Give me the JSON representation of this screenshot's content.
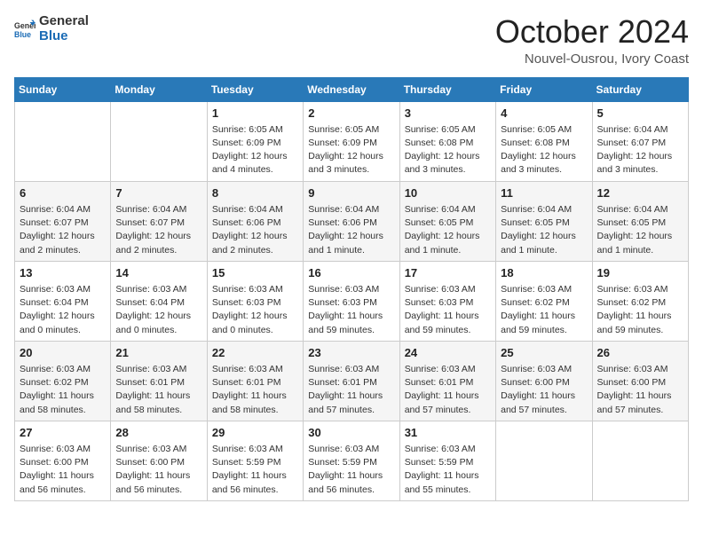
{
  "logo": {
    "text_general": "General",
    "text_blue": "Blue",
    "tagline": "GeneralBlue"
  },
  "header": {
    "month": "October 2024",
    "location": "Nouvel-Ousrou, Ivory Coast"
  },
  "days_of_week": [
    "Sunday",
    "Monday",
    "Tuesday",
    "Wednesday",
    "Thursday",
    "Friday",
    "Saturday"
  ],
  "weeks": [
    [
      {
        "day": "",
        "info": ""
      },
      {
        "day": "",
        "info": ""
      },
      {
        "day": "1",
        "info": "Sunrise: 6:05 AM\nSunset: 6:09 PM\nDaylight: 12 hours and 4 minutes."
      },
      {
        "day": "2",
        "info": "Sunrise: 6:05 AM\nSunset: 6:09 PM\nDaylight: 12 hours and 3 minutes."
      },
      {
        "day": "3",
        "info": "Sunrise: 6:05 AM\nSunset: 6:08 PM\nDaylight: 12 hours and 3 minutes."
      },
      {
        "day": "4",
        "info": "Sunrise: 6:05 AM\nSunset: 6:08 PM\nDaylight: 12 hours and 3 minutes."
      },
      {
        "day": "5",
        "info": "Sunrise: 6:04 AM\nSunset: 6:07 PM\nDaylight: 12 hours and 3 minutes."
      }
    ],
    [
      {
        "day": "6",
        "info": "Sunrise: 6:04 AM\nSunset: 6:07 PM\nDaylight: 12 hours and 2 minutes."
      },
      {
        "day": "7",
        "info": "Sunrise: 6:04 AM\nSunset: 6:07 PM\nDaylight: 12 hours and 2 minutes."
      },
      {
        "day": "8",
        "info": "Sunrise: 6:04 AM\nSunset: 6:06 PM\nDaylight: 12 hours and 2 minutes."
      },
      {
        "day": "9",
        "info": "Sunrise: 6:04 AM\nSunset: 6:06 PM\nDaylight: 12 hours and 1 minute."
      },
      {
        "day": "10",
        "info": "Sunrise: 6:04 AM\nSunset: 6:05 PM\nDaylight: 12 hours and 1 minute."
      },
      {
        "day": "11",
        "info": "Sunrise: 6:04 AM\nSunset: 6:05 PM\nDaylight: 12 hours and 1 minute."
      },
      {
        "day": "12",
        "info": "Sunrise: 6:04 AM\nSunset: 6:05 PM\nDaylight: 12 hours and 1 minute."
      }
    ],
    [
      {
        "day": "13",
        "info": "Sunrise: 6:03 AM\nSunset: 6:04 PM\nDaylight: 12 hours and 0 minutes."
      },
      {
        "day": "14",
        "info": "Sunrise: 6:03 AM\nSunset: 6:04 PM\nDaylight: 12 hours and 0 minutes."
      },
      {
        "day": "15",
        "info": "Sunrise: 6:03 AM\nSunset: 6:03 PM\nDaylight: 12 hours and 0 minutes."
      },
      {
        "day": "16",
        "info": "Sunrise: 6:03 AM\nSunset: 6:03 PM\nDaylight: 11 hours and 59 minutes."
      },
      {
        "day": "17",
        "info": "Sunrise: 6:03 AM\nSunset: 6:03 PM\nDaylight: 11 hours and 59 minutes."
      },
      {
        "day": "18",
        "info": "Sunrise: 6:03 AM\nSunset: 6:02 PM\nDaylight: 11 hours and 59 minutes."
      },
      {
        "day": "19",
        "info": "Sunrise: 6:03 AM\nSunset: 6:02 PM\nDaylight: 11 hours and 59 minutes."
      }
    ],
    [
      {
        "day": "20",
        "info": "Sunrise: 6:03 AM\nSunset: 6:02 PM\nDaylight: 11 hours and 58 minutes."
      },
      {
        "day": "21",
        "info": "Sunrise: 6:03 AM\nSunset: 6:01 PM\nDaylight: 11 hours and 58 minutes."
      },
      {
        "day": "22",
        "info": "Sunrise: 6:03 AM\nSunset: 6:01 PM\nDaylight: 11 hours and 58 minutes."
      },
      {
        "day": "23",
        "info": "Sunrise: 6:03 AM\nSunset: 6:01 PM\nDaylight: 11 hours and 57 minutes."
      },
      {
        "day": "24",
        "info": "Sunrise: 6:03 AM\nSunset: 6:01 PM\nDaylight: 11 hours and 57 minutes."
      },
      {
        "day": "25",
        "info": "Sunrise: 6:03 AM\nSunset: 6:00 PM\nDaylight: 11 hours and 57 minutes."
      },
      {
        "day": "26",
        "info": "Sunrise: 6:03 AM\nSunset: 6:00 PM\nDaylight: 11 hours and 57 minutes."
      }
    ],
    [
      {
        "day": "27",
        "info": "Sunrise: 6:03 AM\nSunset: 6:00 PM\nDaylight: 11 hours and 56 minutes."
      },
      {
        "day": "28",
        "info": "Sunrise: 6:03 AM\nSunset: 6:00 PM\nDaylight: 11 hours and 56 minutes."
      },
      {
        "day": "29",
        "info": "Sunrise: 6:03 AM\nSunset: 5:59 PM\nDaylight: 11 hours and 56 minutes."
      },
      {
        "day": "30",
        "info": "Sunrise: 6:03 AM\nSunset: 5:59 PM\nDaylight: 11 hours and 56 minutes."
      },
      {
        "day": "31",
        "info": "Sunrise: 6:03 AM\nSunset: 5:59 PM\nDaylight: 11 hours and 55 minutes."
      },
      {
        "day": "",
        "info": ""
      },
      {
        "day": "",
        "info": ""
      }
    ]
  ]
}
